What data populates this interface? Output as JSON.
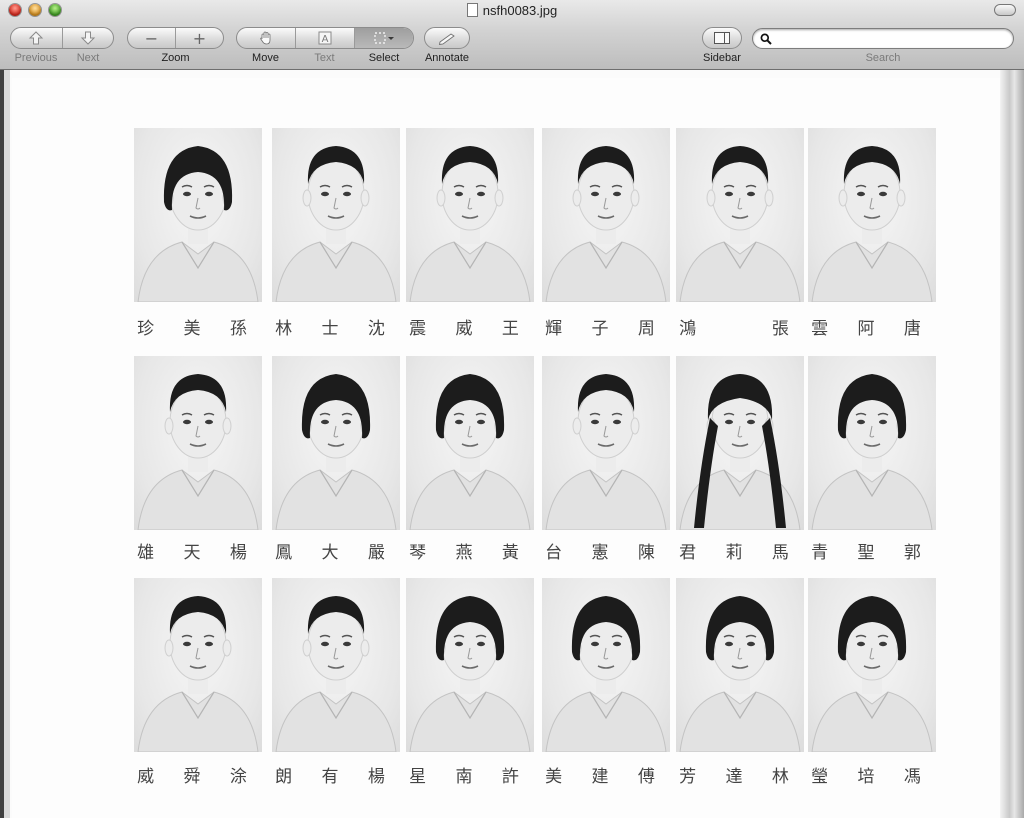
{
  "window": {
    "title": "nsfh0083.jpg"
  },
  "toolbar": {
    "previous_label": "Previous",
    "next_label": "Next",
    "zoom_label": "Zoom",
    "move_label": "Move",
    "text_label": "Text",
    "select_label": "Select",
    "annotate_label": "Annotate",
    "sidebar_label": "Sidebar",
    "search_label": "Search",
    "search_value": "",
    "zoom_out_glyph": "−",
    "zoom_in_glyph": "+"
  },
  "icons": [
    "up-arrow-icon",
    "down-arrow-icon",
    "hand-icon",
    "text-select-icon",
    "marquee-select-icon",
    "pencil-icon",
    "sidebar-icon",
    "magnifier-icon",
    "document-icon"
  ],
  "colors": {
    "hair": "#1c1c1c",
    "face": "#ececec",
    "shirt": "#e2e2e2"
  },
  "yearbook": {
    "rows": [
      [
        {
          "name": "珍 美 孫",
          "hair": "bob"
        },
        {
          "name": "林 士 沈",
          "hair": "short"
        },
        {
          "name": "震 威 王",
          "hair": "short"
        },
        {
          "name": "輝 子 周",
          "hair": "short"
        },
        {
          "name": "鴻 　 張",
          "hair": "short"
        },
        {
          "name": "雲 阿 唐",
          "hair": "short"
        }
      ],
      [
        {
          "name": "雄 天 楊",
          "hair": "short"
        },
        {
          "name": "鳳 大 嚴",
          "hair": "bob"
        },
        {
          "name": "琴 燕 黃",
          "hair": "bob"
        },
        {
          "name": "台 憲 陳",
          "hair": "short"
        },
        {
          "name": "君 莉 馬",
          "hair": "braids"
        },
        {
          "name": "青 聖 郭",
          "hair": "bob"
        }
      ],
      [
        {
          "name": "威 舜 涂",
          "hair": "short"
        },
        {
          "name": "朗 有 楊",
          "hair": "short"
        },
        {
          "name": "星 南 許",
          "hair": "bob"
        },
        {
          "name": "美 建 傅",
          "hair": "bob"
        },
        {
          "name": "芳 達 林",
          "hair": "bob"
        },
        {
          "name": "瑩 培 馮",
          "hair": "bob"
        }
      ]
    ]
  }
}
